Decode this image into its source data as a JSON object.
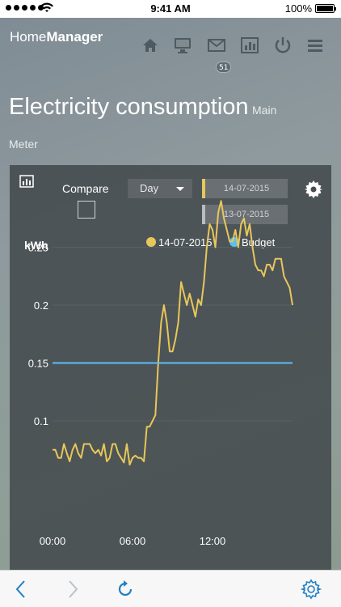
{
  "status_bar": {
    "time": "9:41 AM",
    "battery": "100%"
  },
  "header": {
    "brand_light": "Home",
    "brand_bold": "Manager",
    "nav_icons": [
      "home-icon",
      "monitor-icon",
      "mail-icon",
      "chart-icon",
      "power-icon",
      "menu-icon"
    ],
    "mail_badge": "51"
  },
  "page": {
    "title": "Electricity consumption",
    "subtitle_part1": "Main",
    "subtitle_part2": "Meter"
  },
  "controls": {
    "compare_label": "Compare",
    "compare_checked": false,
    "period": "Day",
    "date_primary": "14-07-2015",
    "date_secondary": "13-07-2015"
  },
  "colors": {
    "series_primary": "#e8c75a",
    "budget": "#5bc0f5",
    "accent_icons": "#1f7fc4"
  },
  "chart_data": {
    "type": "line",
    "ylabel": "kWh",
    "ylim": [
      0.06,
      0.3
    ],
    "yticks": [
      "0.1",
      "0.15",
      "0.2",
      "0.25"
    ],
    "x_tick_labels": [
      "00:00",
      "06:00",
      "12:00"
    ],
    "legend_position": "top",
    "series": [
      {
        "name": "14-07-2015",
        "color": "#e8c75a",
        "x_hours": [
          0.0,
          0.25,
          0.5,
          0.75,
          1.0,
          1.25,
          1.5,
          1.75,
          2.0,
          2.25,
          2.5,
          2.75,
          3.0,
          3.25,
          3.5,
          3.75,
          4.0,
          4.25,
          4.5,
          4.75,
          5.0,
          5.25,
          5.5,
          5.75,
          6.0,
          6.25,
          6.5,
          6.75,
          7.0,
          7.25,
          7.5,
          7.75,
          8.0,
          8.25,
          8.5,
          8.75,
          9.0,
          9.25,
          9.5,
          9.75,
          10.0,
          10.25,
          10.5,
          10.75,
          11.0,
          11.25,
          11.5,
          11.75,
          12.0,
          12.25,
          12.5,
          12.75,
          13.0,
          13.25,
          13.5,
          13.75,
          14.0,
          14.25,
          14.5,
          14.75,
          15.0,
          15.25,
          15.5,
          15.75,
          16.0,
          16.25,
          16.5,
          16.75,
          17.0,
          17.25,
          17.5,
          17.75,
          18.0
        ],
        "values": [
          0.075,
          0.075,
          0.068,
          0.068,
          0.08,
          0.072,
          0.065,
          0.075,
          0.08,
          0.072,
          0.068,
          0.08,
          0.08,
          0.08,
          0.075,
          0.072,
          0.075,
          0.07,
          0.08,
          0.065,
          0.068,
          0.08,
          0.08,
          0.072,
          0.068,
          0.064,
          0.08,
          0.062,
          0.068,
          0.07,
          0.068,
          0.068,
          0.065,
          0.095,
          0.095,
          0.1,
          0.105,
          0.15,
          0.185,
          0.2,
          0.185,
          0.16,
          0.16,
          0.17,
          0.185,
          0.22,
          0.21,
          0.2,
          0.21,
          0.2,
          0.19,
          0.205,
          0.2,
          0.22,
          0.25,
          0.27,
          0.265,
          0.25,
          0.28,
          0.29,
          0.275,
          0.265,
          0.255,
          0.255,
          0.265,
          0.25,
          0.27,
          0.275,
          0.26,
          0.27,
          0.25,
          0.235,
          0.23,
          0.23,
          0.225,
          0.235,
          0.235,
          0.23,
          0.24,
          0.24,
          0.24,
          0.225,
          0.22,
          0.215,
          0.2
        ]
      },
      {
        "name": "Budget",
        "color": "#5bc0f5",
        "x_hours": [
          0,
          18
        ],
        "values": [
          0.15,
          0.15
        ]
      }
    ]
  },
  "bottom_bar": {
    "icons": [
      "back-icon",
      "forward-icon",
      "reload-icon",
      "settings-icon"
    ]
  }
}
